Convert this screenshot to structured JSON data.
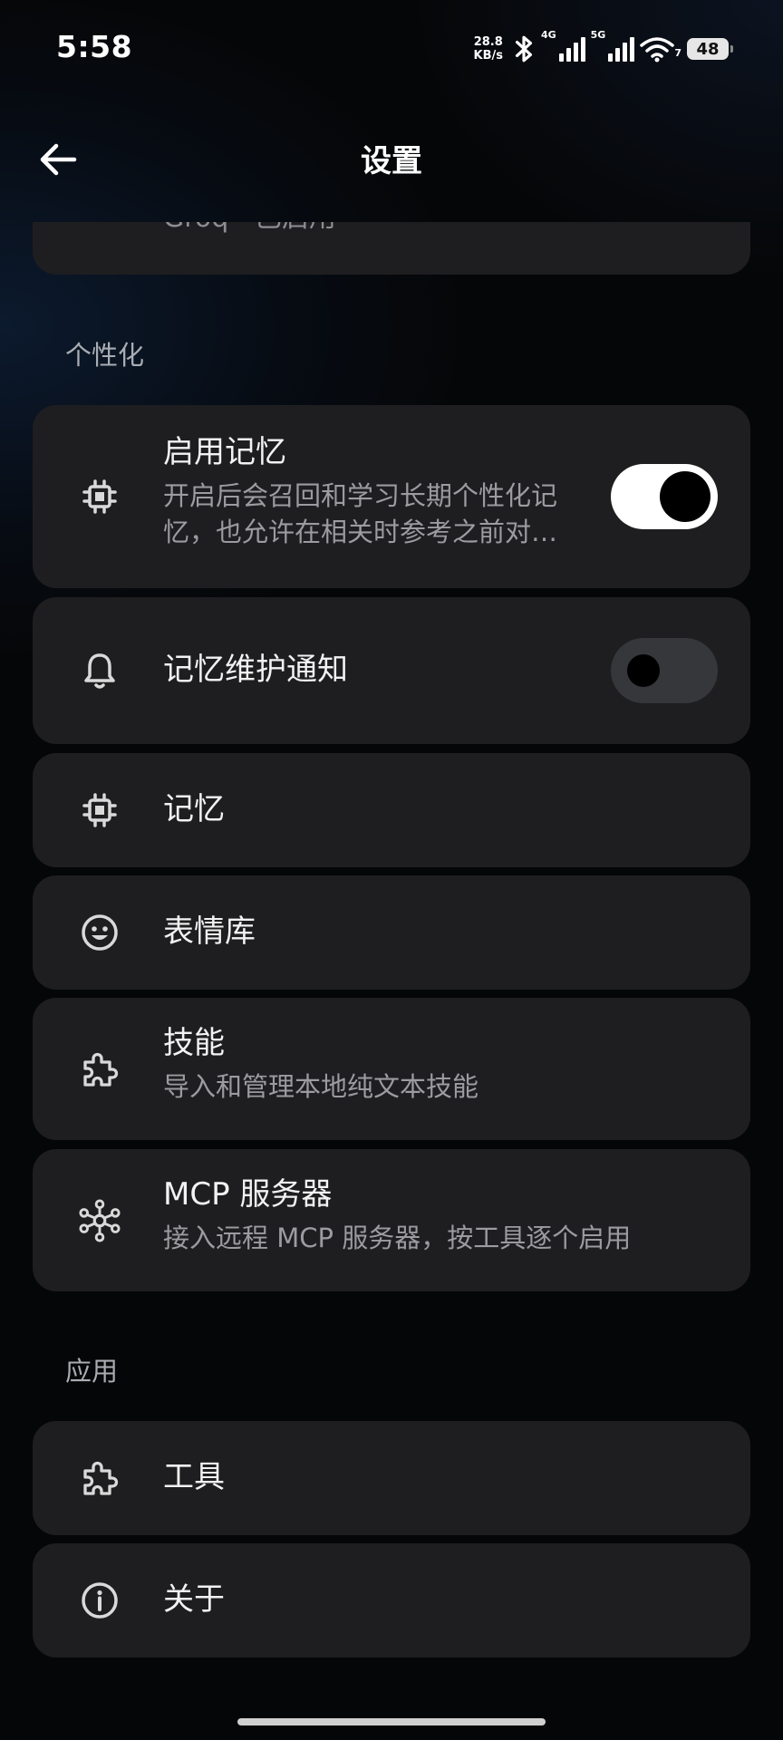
{
  "status_bar": {
    "time": "5:58",
    "net_speed_value": "28.8",
    "net_speed_unit": "KB/s",
    "signal_1_label": "4G",
    "signal_2_label": "5G",
    "wifi_label": "7",
    "battery": "48"
  },
  "header": {
    "title": "设置",
    "back_icon": "arrow-left-icon"
  },
  "top_card": {
    "subtitle": "Groq · 已启用"
  },
  "sections": {
    "personalization": "个性化",
    "app": "应用"
  },
  "items": {
    "enable_memory": {
      "title": "启用记忆",
      "desc": "开启后会召回和学习长期个性化记忆，也允许在相关时参考之前对…",
      "icon": "chip-icon",
      "toggle_on": true
    },
    "memory_notify": {
      "title": "记忆维护通知",
      "icon": "bell-icon",
      "toggle_on": false
    },
    "memory": {
      "title": "记忆",
      "icon": "chip-icon"
    },
    "emoji": {
      "title": "表情库",
      "icon": "smiley-icon"
    },
    "skills": {
      "title": "技能",
      "desc": "导入和管理本地纯文本技能",
      "icon": "puzzle-icon"
    },
    "mcp": {
      "title": "MCP 服务器",
      "desc": "接入远程 MCP 服务器，按工具逐个启用",
      "icon": "hub-icon"
    },
    "tools": {
      "title": "工具",
      "icon": "puzzle-icon"
    },
    "about": {
      "title": "关于",
      "icon": "info-icon"
    }
  },
  "colors": {
    "background": "#050607",
    "card": "#1e1e20",
    "text_primary": "#f2f2f2",
    "text_secondary": "#9b9ba0",
    "toggle_on": "#ffffff",
    "toggle_off": "#36373a"
  }
}
